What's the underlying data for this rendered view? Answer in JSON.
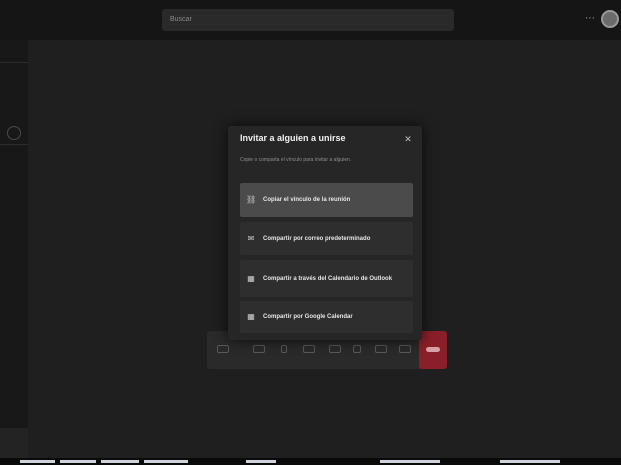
{
  "titlebar": {
    "search_placeholder": "Buscar"
  },
  "dialog": {
    "title": "Invitar a alguien a unirse",
    "subtitle": "Copie o comparta el vínculo para invitar a alguien.",
    "close_glyph": "✕",
    "options": [
      {
        "label": "Copiar el vínculo de la reunión",
        "icon": "link-icon",
        "glyph": "⛓"
      },
      {
        "label": "Compartir por correo predeterminado",
        "icon": "mail-icon",
        "glyph": "✉"
      },
      {
        "label": "Compartir a través del Calendario de Outlook",
        "icon": "calendar-icon",
        "glyph": "▦"
      },
      {
        "label": "Compartir por Google Calendar",
        "icon": "calendar-icon",
        "glyph": "▦"
      }
    ]
  },
  "colors": {
    "background": "#1f1f1f",
    "dialog": "#262626",
    "option": "#2e2e2e",
    "option_active": "#4b4b4b",
    "hangup": "#8b1f27"
  }
}
